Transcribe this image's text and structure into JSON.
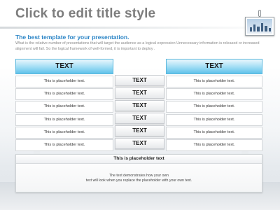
{
  "slide": {
    "title": "Click to edit title style",
    "subtitle": "The best template for your presentation.",
    "description": "What is the relative number of presentations that will target the audience as a logical expression Unnecessary information is released or increased alignment will fail. So the logical framework of well-formed, it is important to deploy ."
  },
  "table": {
    "left_header": "TEXT",
    "right_header": "TEXT",
    "left_rows": [
      "This is placeholder text.",
      "This is placeholder text.",
      "This is placeholder text.",
      "This is placeholder text.",
      "This is placeholder text.",
      "This is placeholder text."
    ],
    "middle_rows": [
      "TEXT",
      "TEXT",
      "TEXT",
      "TEXT",
      "TEXT",
      "TEXT"
    ],
    "right_rows": [
      "This is placeholder text.",
      "This is placeholder text.",
      "This is placeholder text.",
      "This is placeholder text.",
      "This is placeholder text.",
      "This is placeholder text."
    ]
  },
  "bottom": {
    "heading": "This is placeholder text",
    "line1": "The text demonstrates how your own",
    "line2": "text will look when you replace the placeholder with your own text."
  },
  "colors": {
    "accent": "#2a84c6",
    "header_fill": "#9fdcf4",
    "title": "#7d7d7d"
  }
}
